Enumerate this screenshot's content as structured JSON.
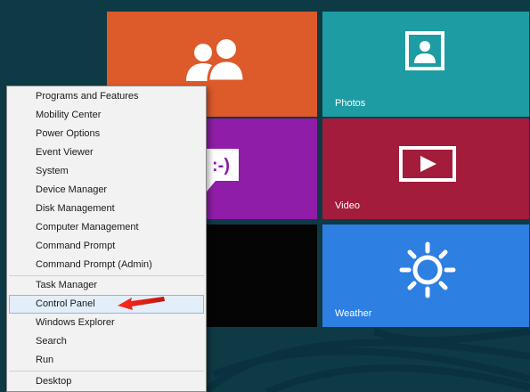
{
  "tiles": {
    "people": {
      "label": "",
      "color": "#dd5a2b",
      "icon": "people-icon"
    },
    "photos": {
      "label": "Photos",
      "color": "#1e9ca3",
      "icon": "photo-icon"
    },
    "messaging": {
      "label": "",
      "color": "#8f1da8",
      "icon": "chat-smiley-icon"
    },
    "video": {
      "label": "Video",
      "color": "#a31c3c",
      "icon": "play-icon"
    },
    "desktop_preview": {
      "label": "",
      "color": "#050505"
    },
    "weather": {
      "label": "Weather",
      "color": "#2d7fe2",
      "icon": "sun-icon"
    }
  },
  "menu": {
    "group1": [
      "Programs and Features",
      "Mobility Center",
      "Power Options",
      "Event Viewer",
      "System",
      "Device Manager",
      "Disk Management",
      "Computer Management",
      "Command Prompt",
      "Command Prompt (Admin)"
    ],
    "group2": [
      "Task Manager",
      "Control Panel",
      "Windows Explorer",
      "Search",
      "Run"
    ],
    "group3": [
      "Desktop"
    ],
    "selected": "Control Panel"
  },
  "annotation": {
    "arrow_color": "#e0231c",
    "points_to": "Control Panel"
  },
  "colors": {
    "background": "#0e3a46",
    "menu_bg": "#f2f2f2",
    "highlight": "#e3eef9"
  }
}
